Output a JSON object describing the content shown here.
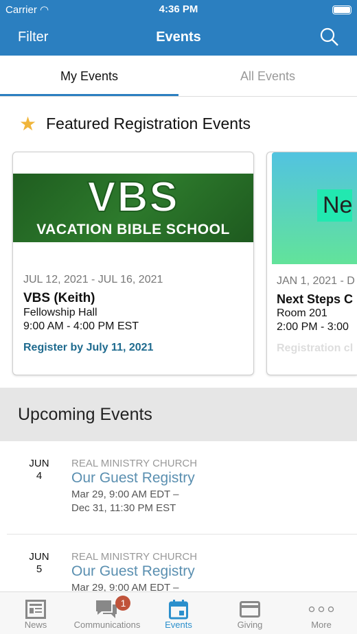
{
  "status": {
    "carrier": "Carrier",
    "time": "4:36 PM"
  },
  "header": {
    "filter": "Filter",
    "title": "Events"
  },
  "tabs": [
    {
      "label": "My Events"
    },
    {
      "label": "All Events"
    }
  ],
  "featured": {
    "heading": "Featured Registration Events",
    "cards": [
      {
        "image_title": "VBS",
        "image_subtitle": "VACATION BIBLE SCHOOL",
        "date": "JUL 12, 2021 - JUL 16, 2021",
        "title": "VBS (Keith)",
        "location": "Fellowship Hall",
        "time": "9:00 AM - 4:00 PM EST",
        "registration": "Register by July 11, 2021"
      },
      {
        "image_title": "Ne",
        "date": "JAN 1, 2021 - D",
        "title": "Next Steps C",
        "location": "Room 201",
        "time": "2:00 PM - 3:00",
        "registration": "Registration cl"
      }
    ]
  },
  "upcoming": {
    "heading": "Upcoming Events",
    "items": [
      {
        "month": "JUN",
        "day": "4",
        "org": "REAL MINISTRY CHURCH",
        "title": "Our Guest Registry",
        "start": "Mar 29, 9:00 AM EDT –",
        "end": "Dec 31, 11:30 PM EST"
      },
      {
        "month": "JUN",
        "day": "5",
        "org": "REAL MINISTRY CHURCH",
        "title": "Our Guest Registry",
        "start": "Mar 29, 9:00 AM EDT –",
        "end": ""
      }
    ]
  },
  "tabbar": [
    {
      "label": "News",
      "icon": "news-icon"
    },
    {
      "label": "Communications",
      "icon": "chat-icon",
      "badge": "1"
    },
    {
      "label": "Events",
      "icon": "calendar-icon"
    },
    {
      "label": "Giving",
      "icon": "card-icon"
    },
    {
      "label": "More",
      "icon": "more-icon"
    }
  ],
  "colors": {
    "header": "#2b7fc0",
    "active_tab": "#2b8fcc",
    "link": "#1e6a8e",
    "star": "#f0b53a",
    "badge": "#c0533a"
  }
}
